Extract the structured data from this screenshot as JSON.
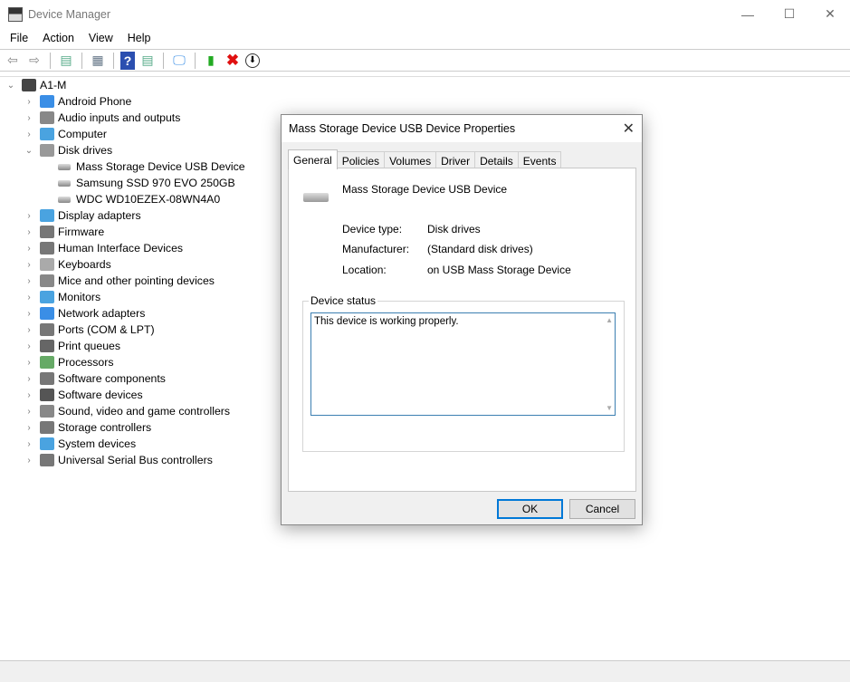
{
  "window": {
    "title": "Device Manager",
    "minimize": "—",
    "maximize": "☐",
    "close": "✕"
  },
  "menu": [
    "File",
    "Action",
    "View",
    "Help"
  ],
  "toolbar": [
    "back-icon",
    "forward-icon",
    "show-hide-console-tree-icon",
    "properties-icon",
    "help-icon",
    "action-pane-icon",
    "scan-hardware-icon",
    "update-driver-icon",
    "uninstall-icon",
    "disable-icon"
  ],
  "tree": {
    "root": "A1-M",
    "categories": [
      {
        "label": "Android Phone",
        "color": "#3a8ee6"
      },
      {
        "label": "Audio inputs and outputs",
        "color": "#888"
      },
      {
        "label": "Computer",
        "color": "#4aa3e0"
      },
      {
        "label": "Disk drives",
        "color": "#999",
        "expanded": true,
        "children": [
          "Mass Storage Device USB Device",
          "Samsung SSD 970 EVO 250GB",
          "WDC WD10EZEX-08WN4A0"
        ]
      },
      {
        "label": "Display adapters",
        "color": "#4aa3e0"
      },
      {
        "label": "Firmware",
        "color": "#777"
      },
      {
        "label": "Human Interface Devices",
        "color": "#777"
      },
      {
        "label": "Keyboards",
        "color": "#aaa"
      },
      {
        "label": "Mice and other pointing devices",
        "color": "#888"
      },
      {
        "label": "Monitors",
        "color": "#4aa3e0"
      },
      {
        "label": "Network adapters",
        "color": "#3a8ee6"
      },
      {
        "label": "Ports (COM & LPT)",
        "color": "#777"
      },
      {
        "label": "Print queues",
        "color": "#666"
      },
      {
        "label": "Processors",
        "color": "#6a6"
      },
      {
        "label": "Software components",
        "color": "#777"
      },
      {
        "label": "Software devices",
        "color": "#555"
      },
      {
        "label": "Sound, video and game controllers",
        "color": "#888"
      },
      {
        "label": "Storage controllers",
        "color": "#777"
      },
      {
        "label": "System devices",
        "color": "#4aa3e0"
      },
      {
        "label": "Universal Serial Bus controllers",
        "color": "#777"
      }
    ]
  },
  "dialog": {
    "title": "Mass Storage Device USB Device Properties",
    "close": "✕",
    "tabs": [
      "General",
      "Policies",
      "Volumes",
      "Driver",
      "Details",
      "Events"
    ],
    "device_name": "Mass Storage Device USB Device",
    "fields": [
      {
        "label": "Device type:",
        "value": "Disk drives"
      },
      {
        "label": "Manufacturer:",
        "value": "(Standard disk drives)"
      },
      {
        "label": "Location:",
        "value": "on USB Mass Storage Device"
      }
    ],
    "status_title": "Device status",
    "status_text": "This device is working properly.",
    "ok": "OK",
    "cancel": "Cancel"
  }
}
